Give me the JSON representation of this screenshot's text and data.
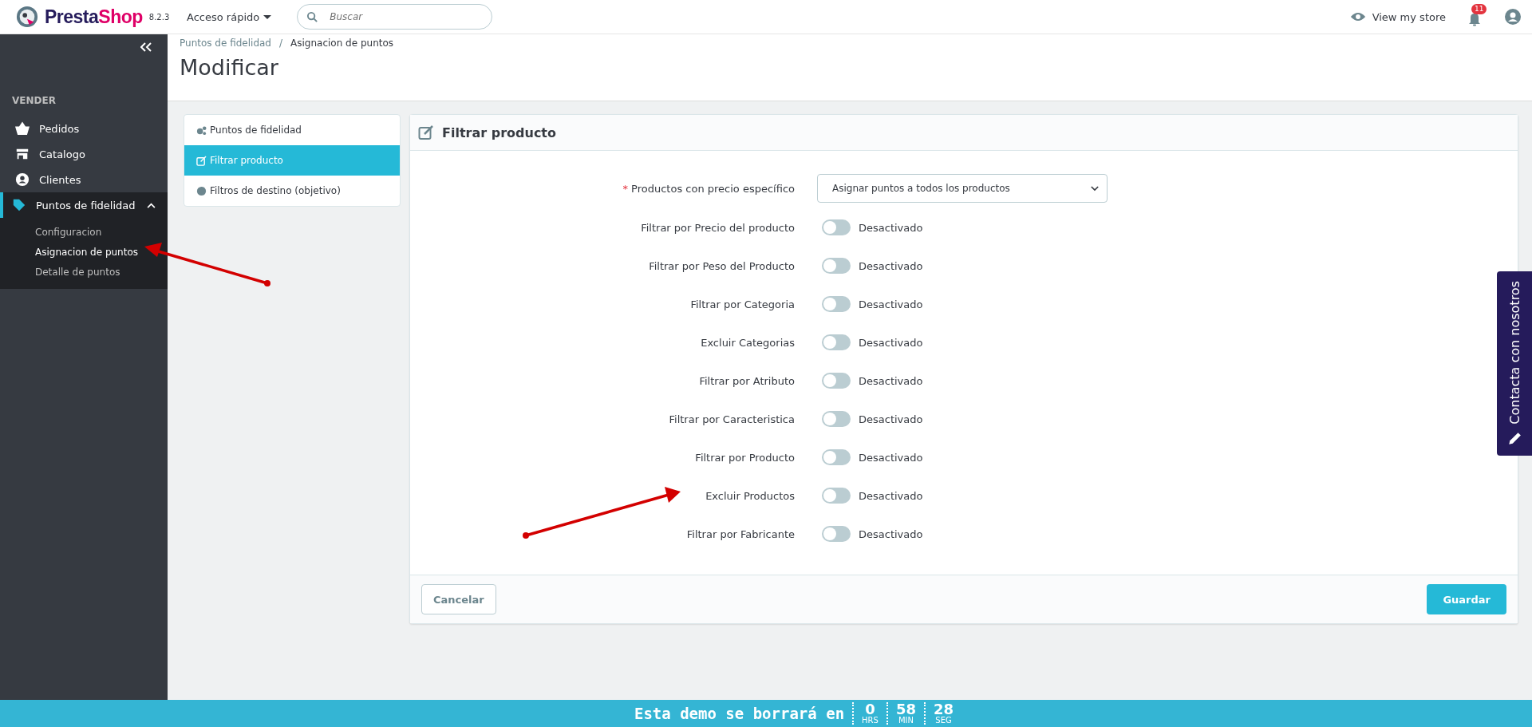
{
  "header": {
    "brand_prefix": "Presta",
    "brand_suffix": "Shop",
    "version": "8.2.3",
    "quick_access": "Acceso rápido",
    "search": {
      "placeholder": "Buscar"
    },
    "view_store": "View my store",
    "notifications": "11"
  },
  "sidebar": {
    "section": "VENDER",
    "items": [
      {
        "label": "Pedidos",
        "selected": false
      },
      {
        "label": "Catalogo",
        "selected": false
      },
      {
        "label": "Clientes",
        "selected": false
      },
      {
        "label": "Puntos de fidelidad",
        "selected": true,
        "expanded": true,
        "children": [
          {
            "label": "Configuracion",
            "selected": false
          },
          {
            "label": "Asignacion de puntos",
            "selected": true
          },
          {
            "label": "Detalle de puntos",
            "selected": false
          }
        ]
      }
    ]
  },
  "breadcrumb": {
    "separator": "/",
    "items": [
      "Puntos de fidelidad",
      "Asignacion de puntos"
    ]
  },
  "page_title": "Modificar",
  "tabs": [
    {
      "label": "Puntos de fidelidad",
      "selected": false
    },
    {
      "label": "Filtrar producto",
      "selected": true
    },
    {
      "label": "Filtros de destino (objetivo)",
      "selected": false
    }
  ],
  "panel": {
    "title": "Filtrar producto",
    "select": {
      "label": "Productos con precio específico",
      "required": "*",
      "value": "Asignar puntos a todos los productos"
    },
    "switches": [
      {
        "label": "Filtrar por Precio del producto",
        "on": false,
        "state": "Desactivado"
      },
      {
        "label": "Filtrar por Peso del Producto",
        "on": false,
        "state": "Desactivado"
      },
      {
        "label": "Filtrar por Categoria",
        "on": false,
        "state": "Desactivado"
      },
      {
        "label": "Excluir Categorias",
        "on": false,
        "state": "Desactivado"
      },
      {
        "label": "Filtrar por Atributo",
        "on": false,
        "state": "Desactivado"
      },
      {
        "label": "Filtrar por Caracteristica",
        "on": false,
        "state": "Desactivado"
      },
      {
        "label": "Filtrar por Producto",
        "on": false,
        "state": "Desactivado"
      },
      {
        "label": "Excluir Productos",
        "on": false,
        "state": "Desactivado"
      },
      {
        "label": "Filtrar por Fabricante",
        "on": false,
        "state": "Desactivado"
      }
    ],
    "cancel": "Cancelar",
    "save": "Guardar"
  },
  "contact_tab": "Contacta con nosotros",
  "demo_bar": {
    "text": "Esta demo se borrará en",
    "units": [
      {
        "value": "0",
        "label": "HRS"
      },
      {
        "value": "58",
        "label": "MIN"
      },
      {
        "value": "28",
        "label": "SEG"
      }
    ]
  }
}
